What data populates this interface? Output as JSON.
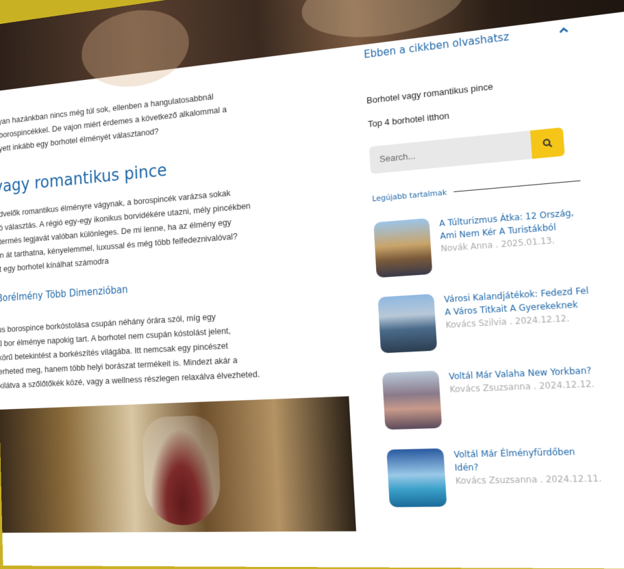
{
  "article": {
    "intro_lines": [
      "olyan hazánkban nincs még túl sok, ellenben a hangulatosabbnál",
      "b borospincékkel.  De vajon miért érdemes a következő alkalommal a",
      "elyett inkább egy borhotel élményét választanod?"
    ],
    "section_heading": "vagy romantikus pince",
    "section_lines": [
      "edvelők romantikus élményre vágynak, a borospincék varázsa sokak",
      "só választás. A régió egy-egy ikonikus borvidékére utazni, mély pincékben",
      "i termés legjavát valóban különleges. De mi lenne, ha az élmény egy",
      "ën át tarthatna, kényelemmel, luxussal és még több felfedeznivalóval?",
      "iit egy borhotel kínálhat számodra"
    ],
    "subheading": "Borélmény Több Dimenzióban",
    "sub_lines": [
      "us borospince borkóstolása csupán néhány órára szól, míg egy",
      "ű bor élménye napokig tart. A borhotel nem csupán kóstolást jelent,",
      "körű betekintést a borkészítés világába. Itt nemcsak egy pincészet",
      "erheted meg, hanem több helyi borászat termékeit is. Mindezt akár a",
      "kilátva a szőlőtőkék közé, vagy a wellness részlegen relaxálva élvezheted."
    ]
  },
  "sidebar": {
    "toc_title": "Ebben a cikkben olvashatsz",
    "toc_items": [
      "Borhotel vagy romantikus pince",
      "Top 4 borhotel itthon"
    ],
    "search_placeholder": "Search...",
    "latest_title": "Legújabb tartalmak",
    "posts": [
      {
        "title": "A Túlturizmus Átka: 12 Ország, Ami Nem Kér A Turistákból",
        "meta": "Novák Anna . 2025.01.13."
      },
      {
        "title": "Városi Kalandjátékok: Fedezd Fel A Város Titkait A Gyerekeknek",
        "meta": "Kovács Szilvia . 2024.12.12."
      },
      {
        "title": "Voltál Már Valaha New Yorkban?",
        "meta": "Kovács Zsuzsanna . 2024.12.12."
      },
      {
        "title": "Voltál Már Élményfürdőben Idén?",
        "meta": "Kovács Zsuzsanna . 2024.12.11."
      }
    ]
  },
  "colors": {
    "accent": "#1f67a8",
    "button": "#f5c518",
    "background": "#c9b124"
  },
  "icons": {
    "search": "search-icon",
    "collapse": "chevron-up-icon"
  }
}
